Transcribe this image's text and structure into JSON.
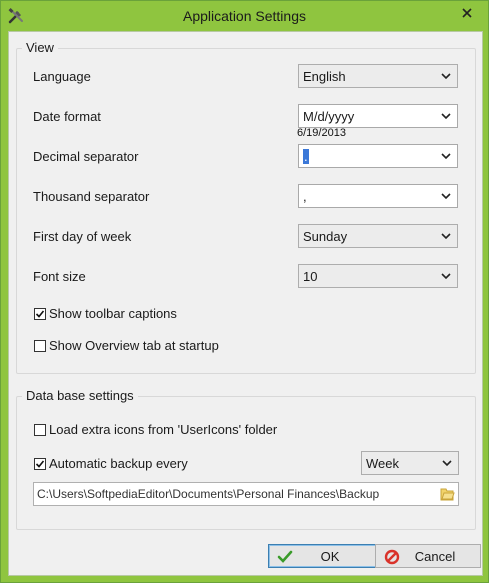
{
  "window": {
    "title": "Application Settings",
    "accent": "#8fc53f"
  },
  "view": {
    "group_title": "View",
    "language": {
      "label": "Language",
      "value": "English"
    },
    "date_format": {
      "label": "Date format",
      "value": "M/d/yyyy",
      "preview": "6/19/2013"
    },
    "decimal_separator": {
      "label": "Decimal separator",
      "value": "."
    },
    "thousand_separator": {
      "label": "Thousand separator",
      "value": ","
    },
    "first_day": {
      "label": "First day of week",
      "value": "Sunday"
    },
    "font_size": {
      "label": "Font size",
      "value": "10"
    },
    "show_toolbar_captions": {
      "label": "Show toolbar captions",
      "checked": true
    },
    "show_overview": {
      "label": "Show Overview tab at startup",
      "checked": false
    }
  },
  "database": {
    "group_title": "Data base settings",
    "load_icons": {
      "label": "Load extra icons from 'UserIcons' folder",
      "checked": false
    },
    "auto_backup": {
      "label": "Automatic backup every",
      "checked": true,
      "interval": "Week"
    },
    "backup_path": "C:\\Users\\SoftpediaEditor\\Documents\\Personal Finances\\Backup"
  },
  "buttons": {
    "ok": "OK",
    "cancel": "Cancel"
  }
}
